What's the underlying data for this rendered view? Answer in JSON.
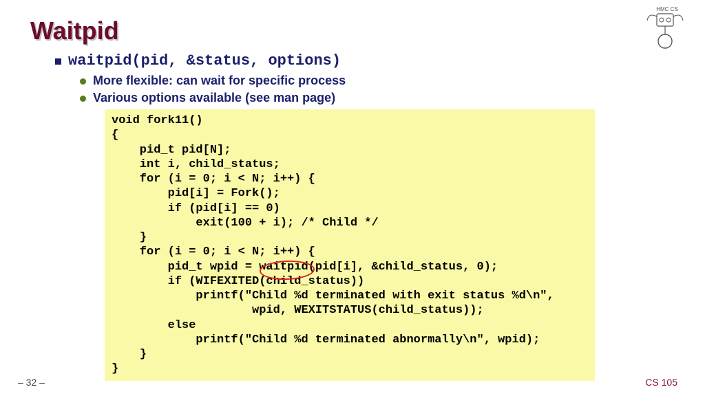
{
  "title": "Waitpid",
  "bullet1": "waitpid(pid, &status, options)",
  "sub_bullets": [
    "More flexible: can wait for specific process",
    "Various options available (see man page)"
  ],
  "code": "void fork11()\n{\n    pid_t pid[N];\n    int i, child_status;\n    for (i = 0; i < N; i++) {\n        pid[i] = Fork();\n        if (pid[i] == 0)\n            exit(100 + i); /* Child */\n    }\n    for (i = 0; i < N; i++) {\n        pid_t wpid = waitpid(pid[i], &child_status, 0);\n        if (WIFEXITED(child_status))\n            printf(\"Child %d terminated with exit status %d\\n\",\n                    wpid, WEXITSTATUS(child_status));\n        else\n            printf(\"Child %d terminated abnormally\\n\", wpid);\n    }\n}",
  "footer_left": "– 32 –",
  "footer_right": "CS 105",
  "logo_label": "HMC CS"
}
